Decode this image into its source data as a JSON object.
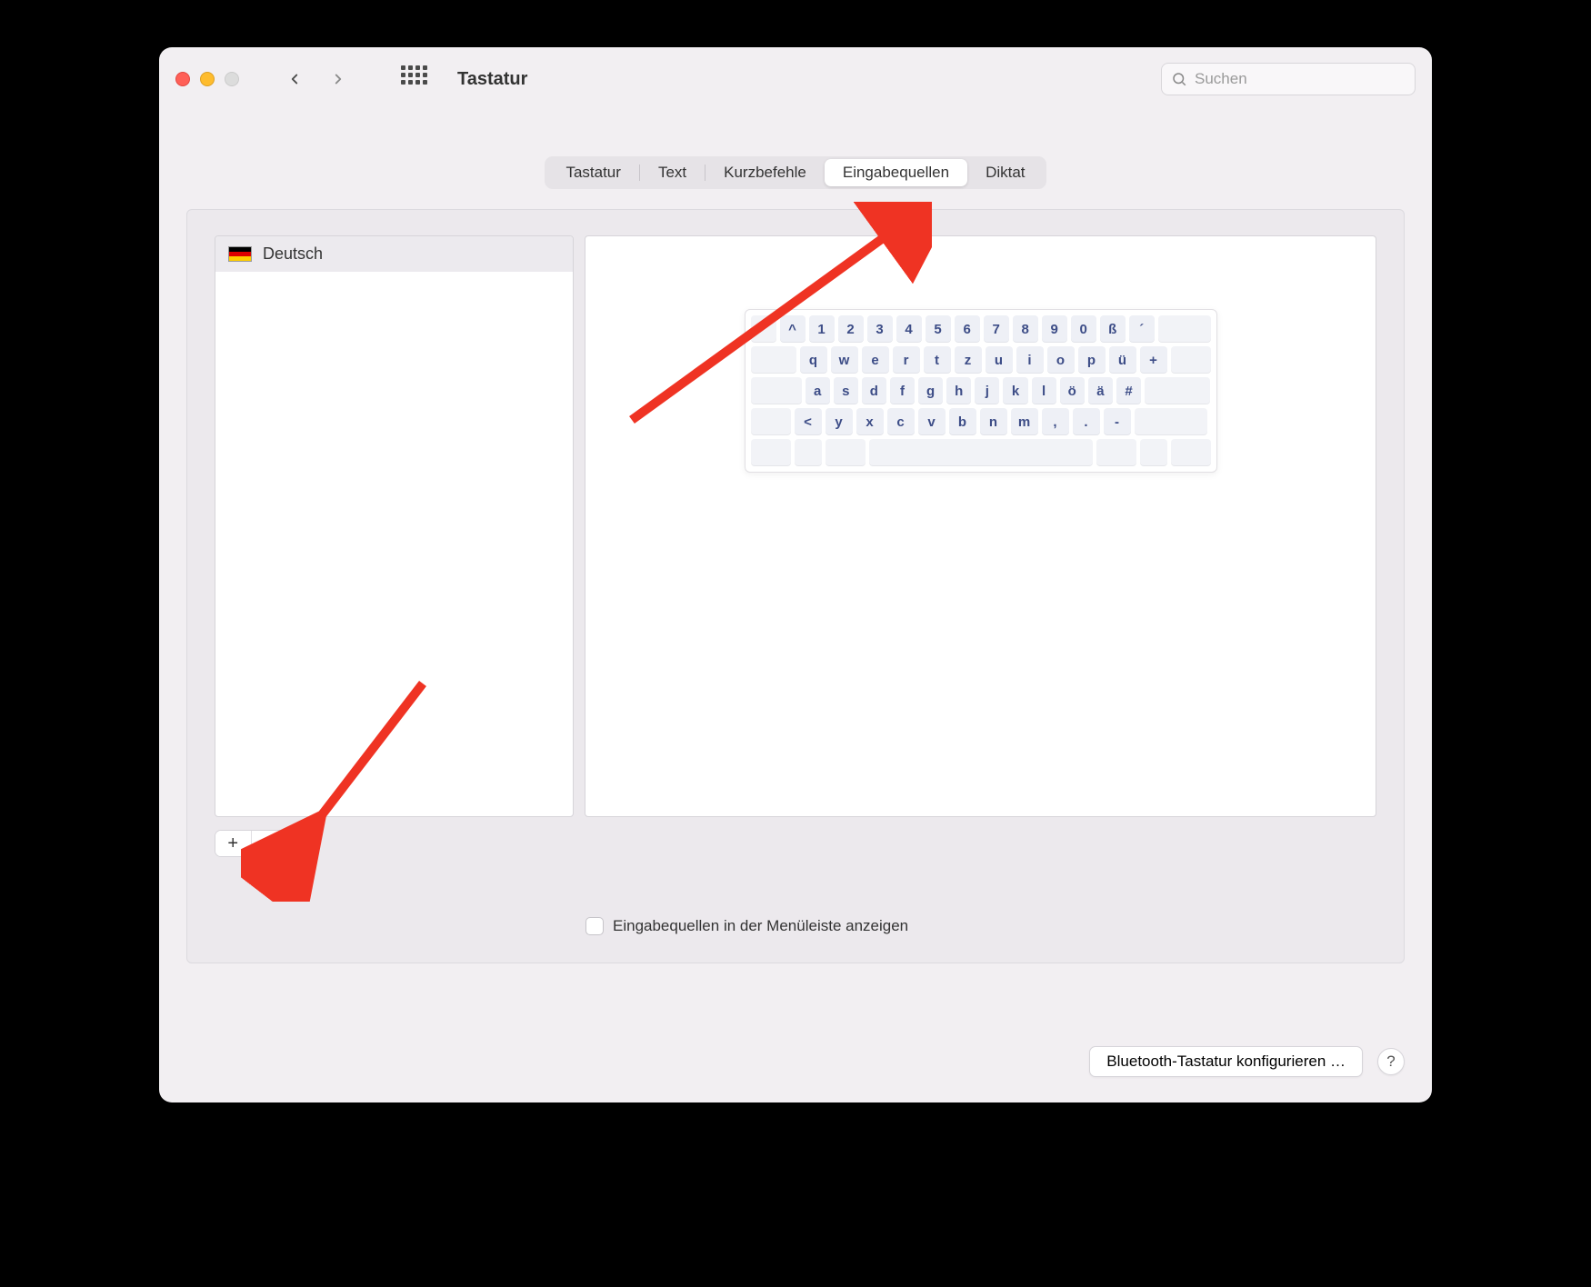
{
  "window": {
    "title": "Tastatur"
  },
  "search": {
    "placeholder": "Suchen"
  },
  "tabs": {
    "items": [
      "Tastatur",
      "Text",
      "Kurzbefehle",
      "Eingabequellen",
      "Diktat"
    ],
    "active_index": 3
  },
  "sources": {
    "items": [
      {
        "label": "Deutsch",
        "flag": "de"
      }
    ]
  },
  "checkbox": {
    "label": "Eingabequellen in der Menüleiste anzeigen",
    "checked": false
  },
  "footer": {
    "bluetooth": "Bluetooth-Tastatur konfigurieren …",
    "help": "?"
  },
  "keyboard_preview": {
    "rows": [
      [
        "^",
        "1",
        "2",
        "3",
        "4",
        "5",
        "6",
        "7",
        "8",
        "9",
        "0",
        "ß",
        "´"
      ],
      [
        "q",
        "w",
        "e",
        "r",
        "t",
        "z",
        "u",
        "i",
        "o",
        "p",
        "ü",
        "+"
      ],
      [
        "a",
        "s",
        "d",
        "f",
        "g",
        "h",
        "j",
        "k",
        "l",
        "ö",
        "ä",
        "#"
      ],
      [
        "<",
        "y",
        "x",
        "c",
        "v",
        "b",
        "n",
        "m",
        ",",
        ".",
        "-"
      ]
    ]
  },
  "icons": {
    "plus": "+",
    "minus": "−"
  }
}
